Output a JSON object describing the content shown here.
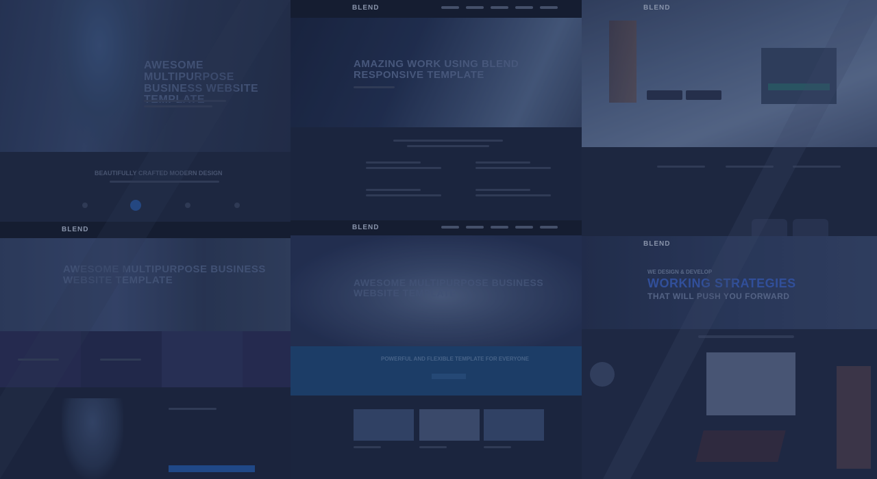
{
  "brand": "BLEND",
  "panels": {
    "p1": {
      "hero_title_1": "AWESOME MULTIPURPOSE",
      "hero_title_2": "BUSINESS WEBSITE",
      "hero_title_3": "TEMPLATE",
      "section_heading": "BEAUTIFULLY CRAFTED MODERN DESIGN"
    },
    "p2": {
      "hero_title_1": "AMAZING WORK USING BLEND",
      "hero_title_2": "RESPONSIVE TEMPLATE"
    },
    "p4": {
      "hero_title_1": "AWESOME MULTIPURPOSE BUSINESS",
      "hero_title_2": "WEBSITE TEMPLATE"
    },
    "p5": {
      "hero_title_1": "AWESOME MULTIPURPOSE BUSINESS",
      "hero_title_2": "WEBSITE TEMPLATE",
      "cta_text": "POWERFUL AND FLEXIBLE TEMPLATE FOR EVERYONE"
    },
    "p6": {
      "eyebrow": "WE DESIGN & DEVELOP",
      "hero_title_1": "WORKING STRATEGIES",
      "hero_title_2": "THAT WILL PUSH YOU FORWARD"
    }
  },
  "colors": {
    "background": "#1a2238",
    "accent": "#2a6fd6",
    "title": "#53668f"
  }
}
